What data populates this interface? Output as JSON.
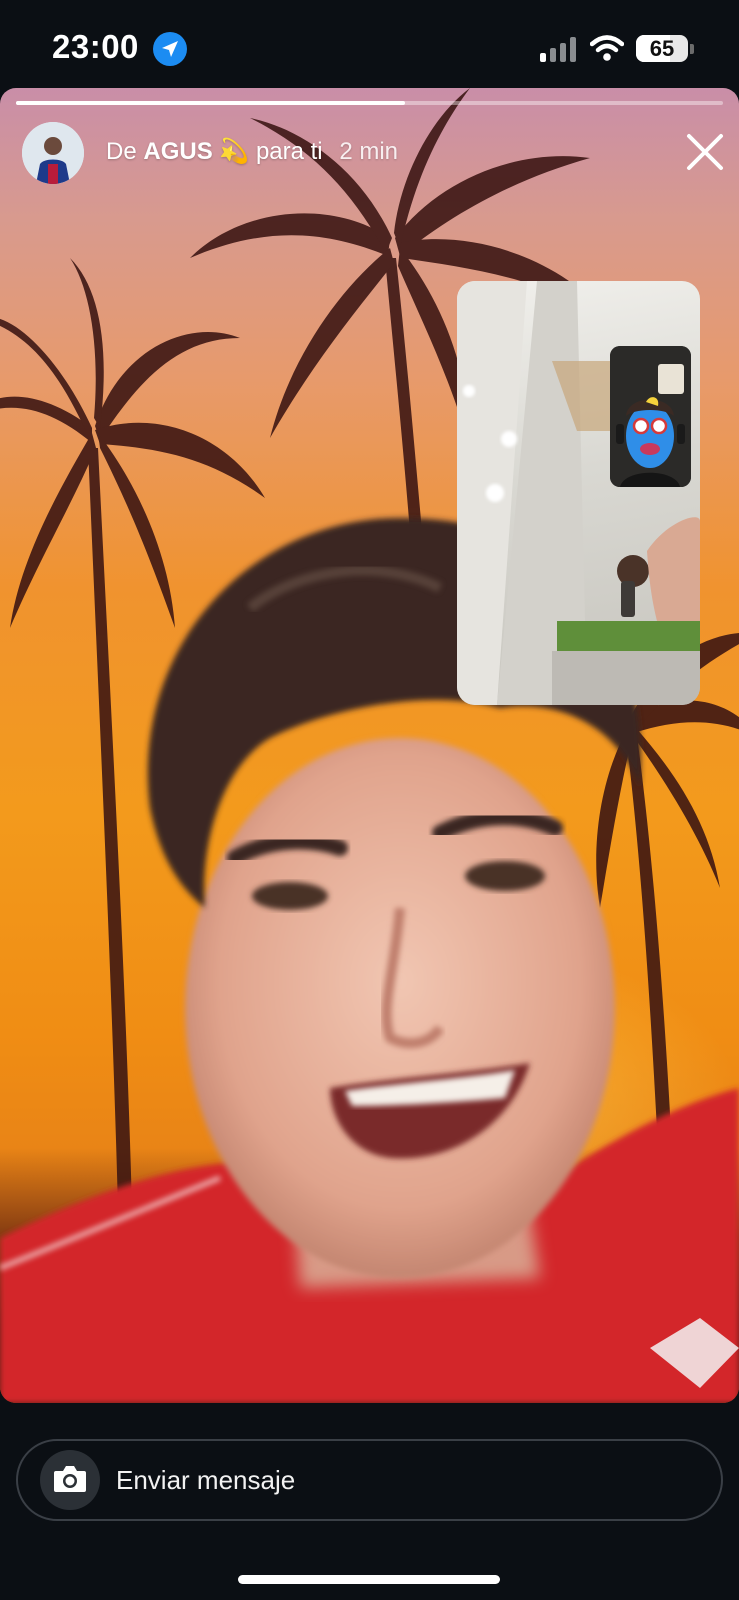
{
  "status_bar": {
    "time": "23:00",
    "location_icon": "location-arrow-icon",
    "signal_icon": "cellular-signal-icon",
    "wifi_icon": "wifi-icon",
    "battery_percent": "65",
    "battery_level": 0.65
  },
  "story": {
    "progress": 0.55,
    "from_label": "De",
    "sender_name": "AGUS",
    "sender_emoji": "💫",
    "to_label": "para ti",
    "time_ago": "2 min",
    "close_icon": "close-icon"
  },
  "composer": {
    "camera_icon": "camera-icon",
    "placeholder": "Enviar mensaje"
  },
  "colors": {
    "background": "#0b0f14",
    "sunset_top": "#c98ea8",
    "sunset_mid": "#f39a1c",
    "shirt_red": "#d3262c",
    "location_blue": "#1c8cf2"
  }
}
